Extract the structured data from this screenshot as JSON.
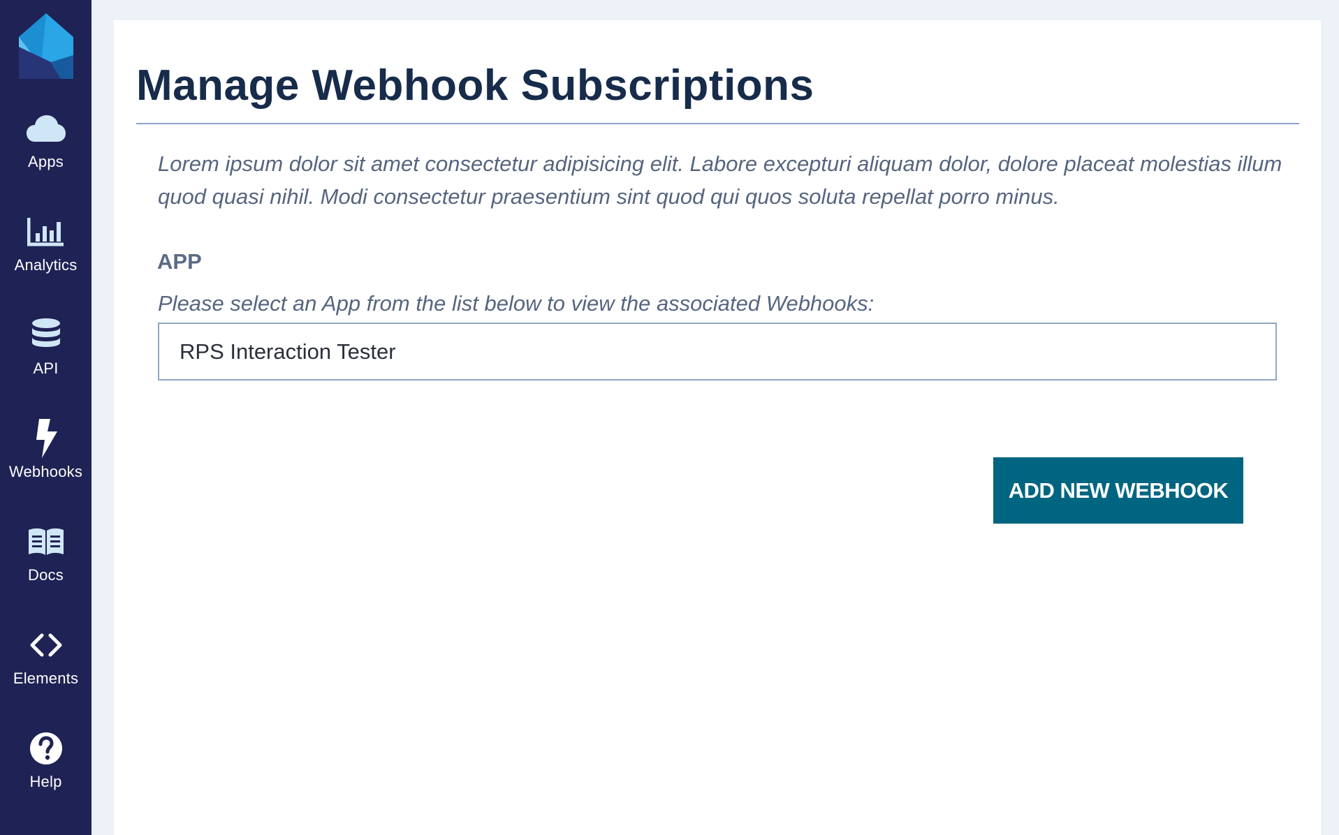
{
  "sidebar": {
    "logo": "house-logo",
    "items": [
      {
        "label": "Apps",
        "icon": "cloud-icon"
      },
      {
        "label": "Analytics",
        "icon": "bar-chart-icon"
      },
      {
        "label": "API",
        "icon": "database-icon"
      },
      {
        "label": "Webhooks",
        "icon": "lightning-icon"
      },
      {
        "label": "Docs",
        "icon": "book-icon"
      },
      {
        "label": "Elements",
        "icon": "code-icon"
      },
      {
        "label": "Help",
        "icon": "question-icon"
      }
    ]
  },
  "main": {
    "title": "Manage Webhook Subscriptions",
    "intro": "Lorem ipsum dolor sit amet consectetur adipisicing elit. Labore excepturi aliquam dolor, dolore placeat molestias illum quod quasi nihil. Modi consectetur praesentium sint quod qui quos soluta repellat porro minus.",
    "app_field": {
      "label": "APP",
      "help": "Please select an App from the list below to view the associated Webhooks:",
      "selected": "RPS Interaction Tester"
    },
    "add_button": "ADD NEW WEBHOOK"
  },
  "colors": {
    "sidebar": "#1f2254",
    "page_background": "#edf2f9",
    "title": "#172b4a",
    "button": "#006580",
    "rule": "#8aa3cc"
  }
}
